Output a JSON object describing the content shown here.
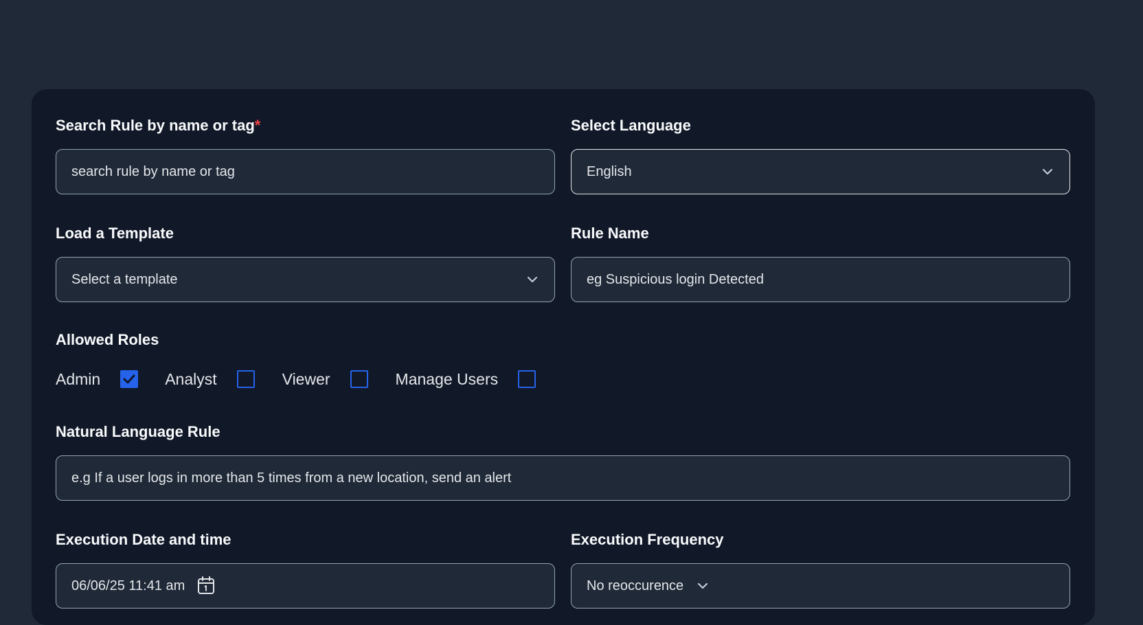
{
  "form": {
    "search_rule": {
      "label": "Search Rule by name or tag",
      "required_mark": "*",
      "placeholder": "search rule by name or tag"
    },
    "select_language": {
      "label": "Select Language",
      "value": "English"
    },
    "load_template": {
      "label": "Load  a Template",
      "placeholder": "Select a template"
    },
    "rule_name": {
      "label": "Rule Name",
      "placeholder": "eg Suspicious login Detected"
    },
    "allowed_roles": {
      "label": "Allowed Roles",
      "roles": [
        {
          "label": "Admin",
          "checked": true
        },
        {
          "label": "Analyst",
          "checked": false
        },
        {
          "label": "Viewer",
          "checked": false
        },
        {
          "label": "Manage Users",
          "checked": false
        }
      ]
    },
    "natural_language_rule": {
      "label": "Natural Language Rule",
      "placeholder": "e.g  If a user logs in more than 5 times from a new location, send an alert"
    },
    "execution_datetime": {
      "label": "Execution Date and time",
      "value": "06/06/25  11:41 am",
      "icon": "calendar-icon"
    },
    "execution_frequency": {
      "label": "Execution Frequency",
      "value": "No reoccurence",
      "icon": "chevron-down-icon"
    }
  },
  "colors": {
    "page_bg": "#1f2937",
    "card_bg": "#111827",
    "input_bg": "#1f2937",
    "accent": "#2563eb",
    "required": "#ef4444"
  }
}
